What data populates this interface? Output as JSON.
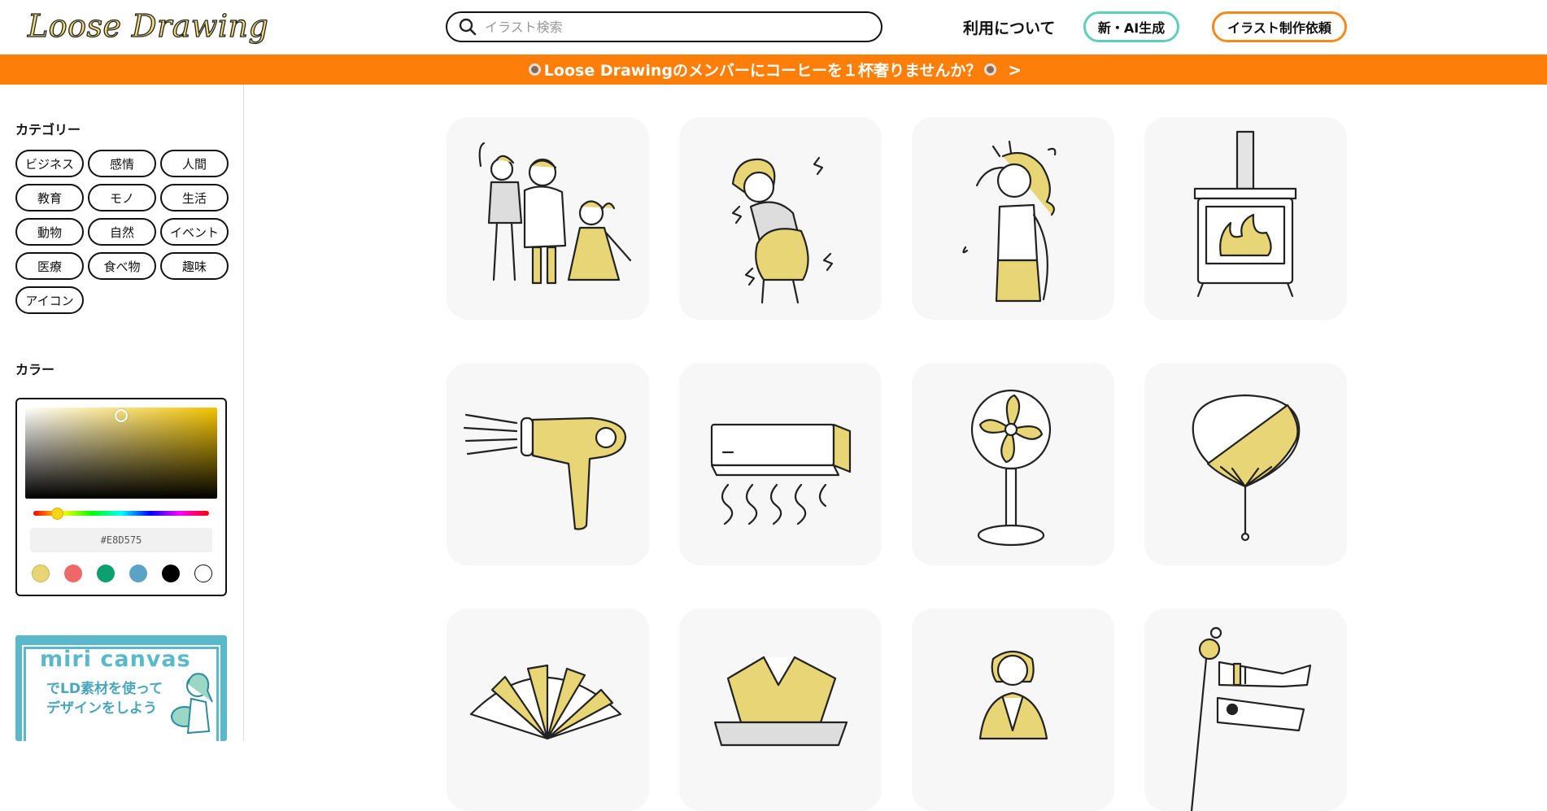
{
  "header": {
    "logo": "Loose Drawing",
    "search_placeholder": "イラスト検索",
    "nav_about": "利用について",
    "nav_ai": "新・AI生成",
    "nav_request": "イラスト制作依頼"
  },
  "banner": {
    "text": "Loose Drawingのメンバーにコーヒーを１杯奢りませんか？",
    "arrow": ">"
  },
  "sidebar": {
    "category_heading": "カテゴリー",
    "categories": [
      "ビジネス",
      "感情",
      "人間",
      "教育",
      "モノ",
      "生活",
      "動物",
      "自然",
      "イベント",
      "医療",
      "食べ物",
      "趣味",
      "アイコン"
    ],
    "color_heading": "カラー",
    "color_hex": "#E8D575",
    "swatches": [
      "#E8D575",
      "#EF6868",
      "#0E9F6E",
      "#5AA2C6",
      "#000000",
      "#FFFFFF"
    ],
    "promo": {
      "brand": "miri canvas",
      "text": "でLD素材を使ってデザインをしよう"
    }
  },
  "illustrations": [
    "family-icon",
    "pregnant-woman-icon",
    "headache-woman-icon",
    "wood-stove-icon",
    "hair-dryer-icon",
    "air-conditioner-icon",
    "electric-fan-icon",
    "uchiwa-fan-icon",
    "folding-fan-icon",
    "kabuto-icon",
    "kimono-child-icon",
    "koinobori-icon"
  ],
  "colors": {
    "accent": "#E8D575",
    "banner": "#FD7E09",
    "ai_border": "#5CCFB6",
    "request_border": "#F28A1C"
  }
}
